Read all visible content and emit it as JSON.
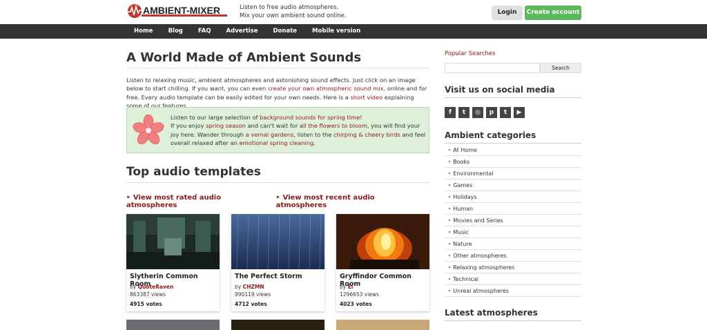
{
  "header": {
    "logo_text": "AMBIENT-MIXER",
    "tagline_line1": "Listen to free audio atmospheres.",
    "tagline_line2": "Mix your own ambient sound online.",
    "login_label": "Login",
    "create_label": "Create account"
  },
  "nav": {
    "items": [
      "Home",
      "Blog",
      "FAQ",
      "Advertise",
      "Donate",
      "Mobile version"
    ]
  },
  "main": {
    "title": "A World Made of Ambient Sounds",
    "intro_part1": "Listen to relaxing music, ambient atmospheres and astonishing sound effects. Just click on an image below to start chilling. If you want, you can even ",
    "intro_link1": "create your own atmospheric sound mix",
    "intro_part2": ", online and for free. Every audio template can be easily edited for your own needs. Here is a ",
    "intro_link2": "short video",
    "intro_part3": " explaining some of our features.",
    "spring": {
      "t1": "Listen to our large selection of ",
      "l1": "background sounds for spring time!",
      "t2": "If you enjoy ",
      "l2": "spring season",
      "t3": " and can't wait for ",
      "l3": "all the flowers to bloom",
      "t4": ", you will find your joy here. Wander through ",
      "l4": "a vernal gardens",
      "t5": ", listen to the ",
      "l5": "chirping & cheery birds",
      "t6": " and feel overall relaxed after an ",
      "l6": "emotional spring cleaning",
      "t7": "."
    },
    "section_title": "Top audio templates",
    "filter_rated": "View most rated audio atmospheres",
    "filter_recent": "View most recent audio atmospheres",
    "cards": [
      {
        "title": "Slytherin Common Room",
        "by": "by ",
        "author": "QuoteRaven",
        "views": "863387 views",
        "votes": "4915 votes"
      },
      {
        "title": "The Perfect Storm",
        "by": "by ",
        "author": "CHZMN",
        "views": "990119 views",
        "votes": "4712 votes"
      },
      {
        "title": "Gryffindor Common Room",
        "by": "by ",
        "author": "El",
        "views": "1296653 views",
        "votes": "4023 votes"
      }
    ]
  },
  "sidebar": {
    "popular": "Popular Searches",
    "search_button": "Search",
    "social_heading": "Visit us on social media",
    "social_icons": [
      "f",
      "t",
      "◎",
      "p",
      "t",
      "▶"
    ],
    "categories_heading": "Ambient categories",
    "categories": [
      "At Home",
      "Books",
      "Environmental",
      "Games",
      "Holidays",
      "Human",
      "Movies and Series",
      "Music",
      "Nature",
      "Other atmospheres",
      "Relaxing atmospheres",
      "Technical",
      "Unreal atmospheres"
    ],
    "latest_heading": "Latest atmospheres"
  },
  "colors": {
    "accent_red": "#8b1a1a",
    "create_green": "#5cb85c",
    "navbar": "#333333",
    "spring_bg": "#dff0d8"
  }
}
